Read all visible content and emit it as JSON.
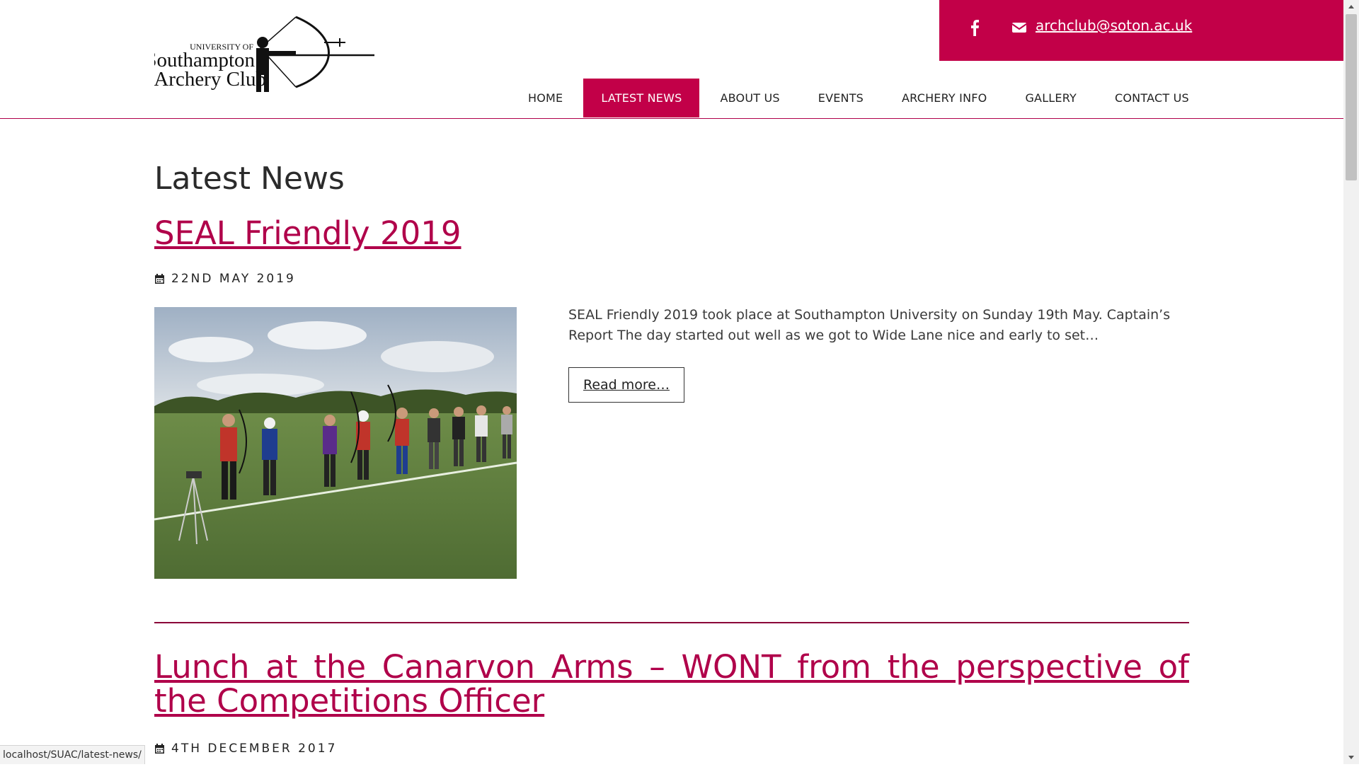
{
  "header": {
    "logo": {
      "line1": "UNIVERSITY OF",
      "line2": "Southampton",
      "line3": "Archery Club"
    },
    "topbar": {
      "facebook_icon": "facebook-icon",
      "email_icon": "envelope-icon",
      "email": "archclub@soton.ac.uk",
      "background": "#c20048"
    },
    "nav": {
      "items": [
        {
          "label": "HOME"
        },
        {
          "label": "LATEST NEWS",
          "active": true
        },
        {
          "label": "ABOUT US"
        },
        {
          "label": "EVENTS"
        },
        {
          "label": "ARCHERY INFO"
        },
        {
          "label": "GALLERY"
        },
        {
          "label": "CONTACT US"
        }
      ]
    }
  },
  "main": {
    "page_title": "Latest News",
    "posts": [
      {
        "title": "SEAL Friendly 2019",
        "date": "22ND MAY 2019",
        "excerpt": "SEAL Friendly 2019 took place at Southampton University on Sunday 19th May. Captain’s Report The day started out well as we got to Wide Lane nice and early to set…",
        "read_more": "Read more…"
      },
      {
        "title": "Lunch at the Canarvon Arms – WONT from the perspective of the Competitions Officer",
        "date": "4TH DECEMBER 2017"
      }
    ]
  },
  "statusbar": {
    "url": "localhost/SUAC/latest-news/"
  },
  "colors": {
    "accent": "#c20048",
    "link": "#b0004a"
  }
}
